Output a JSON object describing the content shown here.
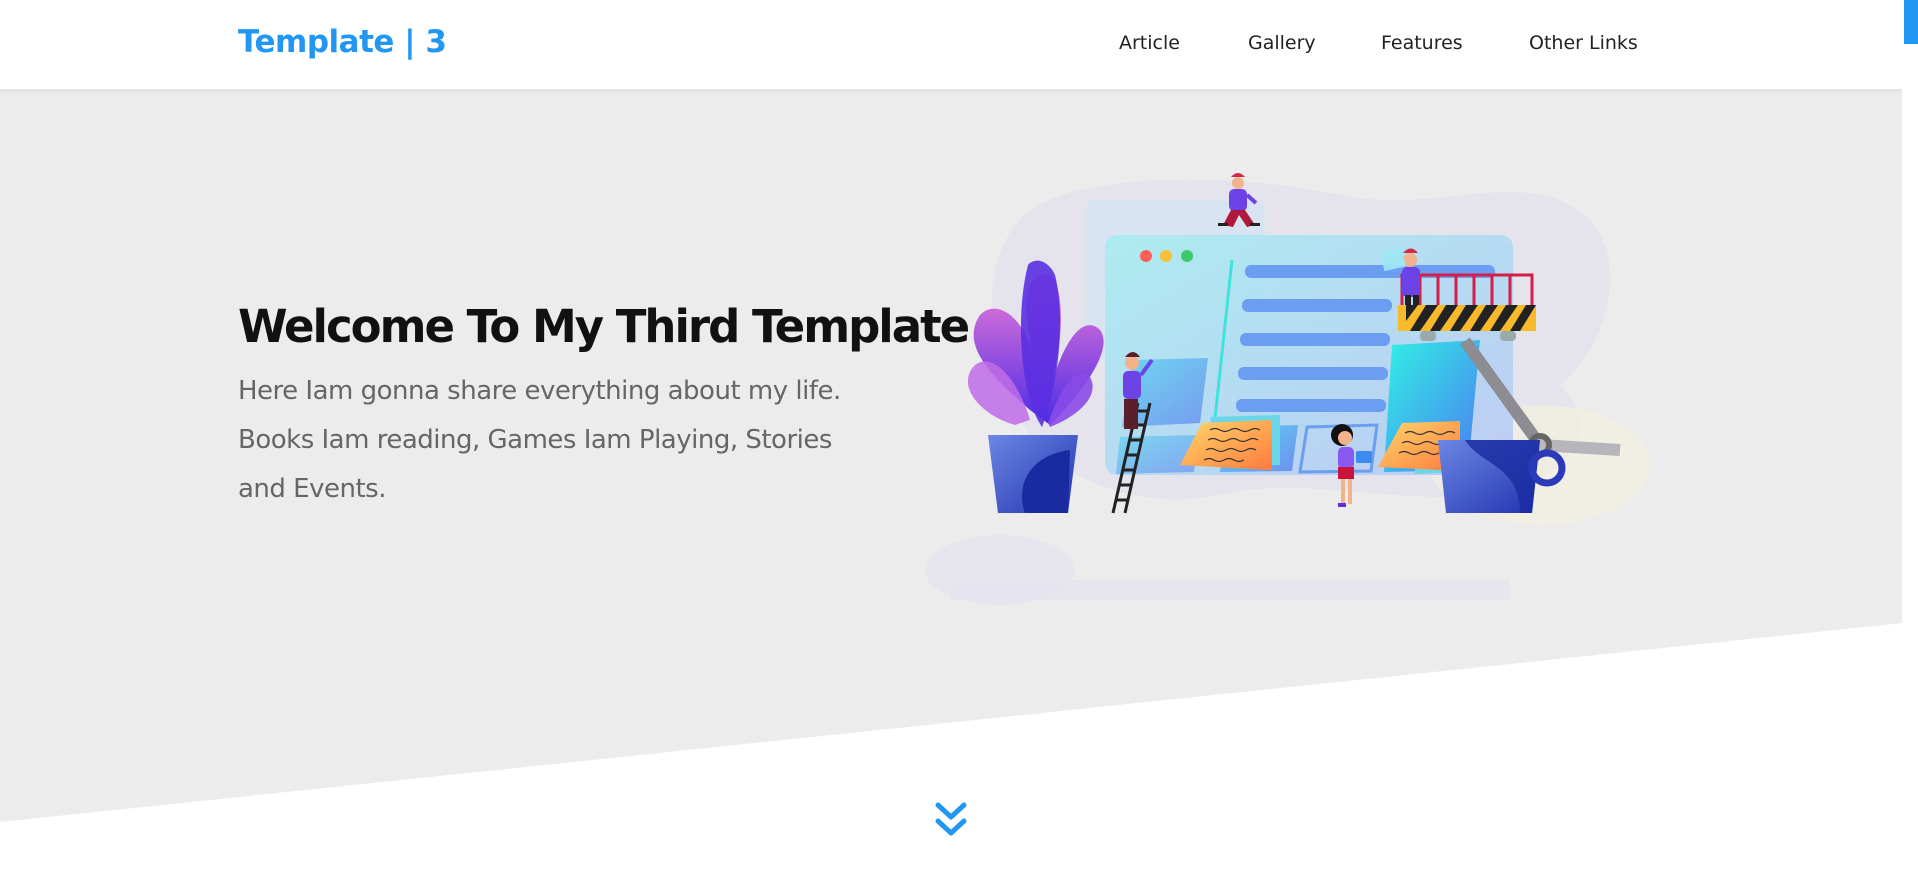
{
  "header": {
    "logo": "Template | 3",
    "nav": [
      {
        "label": "Article"
      },
      {
        "label": "Gallery"
      },
      {
        "label": "Features"
      },
      {
        "label": "Other Links"
      }
    ]
  },
  "hero": {
    "title": "Welcome To My Third Template",
    "description": "Here Iam gonna share everything about my life. Books Iam reading, Games Iam Playing, Stories and Events.",
    "illustration": "web-design-team-illustration"
  },
  "scroll_down": {
    "icon": "double-chevron-down-icon"
  },
  "colors": {
    "accent": "#2196f3",
    "hero_bg": "#ececec",
    "title": "#111111",
    "text": "#666666"
  }
}
